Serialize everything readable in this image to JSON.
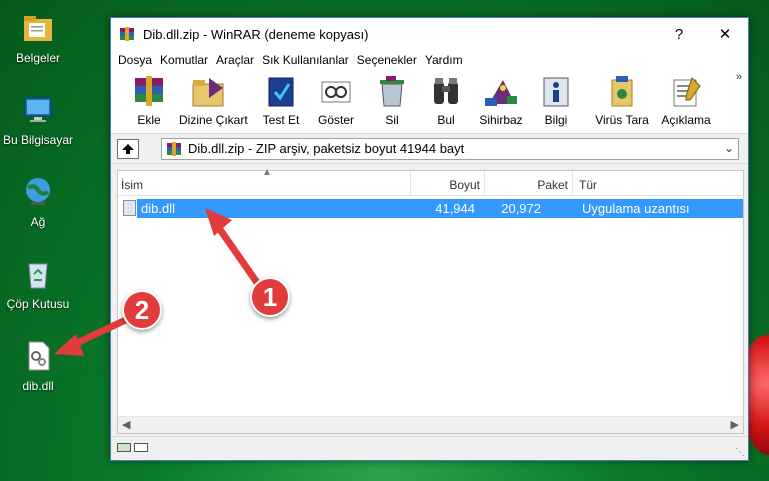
{
  "desktop": {
    "icons": [
      {
        "label": "Belgeler"
      },
      {
        "label": "Bu Bilgisayar"
      },
      {
        "label": "Ağ"
      },
      {
        "label": "Çöp Kutusu"
      },
      {
        "label": "dib.dll"
      }
    ]
  },
  "window": {
    "title": "Dib.dll.zip - WinRAR (deneme kopyası)",
    "help_button": "?",
    "close_button": "✕",
    "menu": [
      "Dosya",
      "Komutlar",
      "Araçlar",
      "Sık Kullanılanlar",
      "Seçenekler",
      "Yardım"
    ],
    "toolbar": [
      {
        "label": "Ekle",
        "icon": "add-icon"
      },
      {
        "label": "Dizine Çıkart",
        "icon": "extract-icon"
      },
      {
        "label": "Test Et",
        "icon": "test-icon"
      },
      {
        "label": "Göster",
        "icon": "view-icon"
      },
      {
        "label": "Sil",
        "icon": "delete-icon"
      },
      {
        "label": "Bul",
        "icon": "find-icon"
      },
      {
        "label": "Sihirbaz",
        "icon": "wizard-icon"
      },
      {
        "label": "Bilgi",
        "icon": "info-icon"
      },
      {
        "label": "Virüs Tara",
        "icon": "virus-scan-icon"
      },
      {
        "label": "Açıklama",
        "icon": "comment-icon"
      }
    ],
    "toolbar_more": "»",
    "address": "Dib.dll.zip - ZIP arşiv, paketsiz boyut 41944 bayt",
    "columns": {
      "name": "İsim",
      "size": "Boyut",
      "packed": "Paket",
      "type": "Tür"
    },
    "files": [
      {
        "name": "dib.dll",
        "size": "41,944",
        "packed": "20,972",
        "type": "Uygulama uzantısı"
      }
    ]
  },
  "annotations": {
    "badge1": "1",
    "badge2": "2",
    "color": "#e23b3b"
  }
}
